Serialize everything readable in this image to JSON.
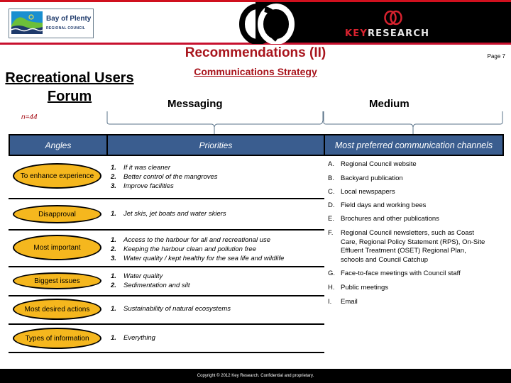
{
  "header": {
    "left_logo": {
      "name": "Bay of Plenty",
      "subname": "REGIONAL COUNCIL"
    },
    "right_logo": {
      "key": "KEY",
      "rest": "RESEARCH"
    },
    "colors": {
      "accent_red": "#a8141c",
      "band_red": "#c8102e",
      "header_blue": "#3a5d8f",
      "oval_yellow": "#f5b71e"
    }
  },
  "title": "Recommendations (II)",
  "subtitle": "Communications Strategy",
  "page_label": "Page 7",
  "forum_title": "Recreational Users Forum",
  "sample_size": "n=44",
  "section_labels": {
    "messaging": "Messaging",
    "medium": "Medium"
  },
  "table": {
    "headers": {
      "angles": "Angles",
      "priorities": "Priorities",
      "channels": "Most preferred communication channels"
    },
    "rows": [
      {
        "angle": "To enhance experience",
        "priorities": [
          "If it was cleaner",
          "Better control of the mangroves",
          "Improve facilities"
        ]
      },
      {
        "angle": "Disapproval",
        "priorities": [
          "Jet skis, jet boats and water skiers"
        ]
      },
      {
        "angle": "Most important",
        "priorities": [
          "Access to the harbour for all and recreational use",
          "Keeping the harbour clean and pollution free",
          "Water quality / kept healthy for the sea life and wildlife"
        ]
      },
      {
        "angle": "Biggest issues",
        "priorities": [
          "Water quality",
          "Sedimentation and silt"
        ]
      },
      {
        "angle": "Most desired actions",
        "priorities": [
          "Sustainability of natural ecosystems"
        ]
      },
      {
        "angle": "Types of information",
        "priorities": [
          "Everything"
        ]
      }
    ],
    "numbers": [
      "1.",
      "2.",
      "3."
    ],
    "channels": [
      {
        "letter": "A.",
        "text": "Regional Council website"
      },
      {
        "letter": "B.",
        "text": "Backyard publication"
      },
      {
        "letter": "C.",
        "text": "Local newspapers"
      },
      {
        "letter": "D.",
        "text": "Field days and working bees"
      },
      {
        "letter": "E.",
        "text": "Brochures and other publications"
      },
      {
        "letter": "F.",
        "text": "Regional Council newsletters, such as Coast Care, Regional Policy Statement (RPS), On-Site Effluent Treatment (OSET) Regional Plan, schools and Council Catchup"
      },
      {
        "letter": "G.",
        "text": "Face-to-face meetings with Council staff"
      },
      {
        "letter": "H.",
        "text": "Public meetings"
      },
      {
        "letter": "I.",
        "text": "Email"
      }
    ]
  },
  "footer": "Copyright © 2012 Key Research. Confidential and proprietary."
}
